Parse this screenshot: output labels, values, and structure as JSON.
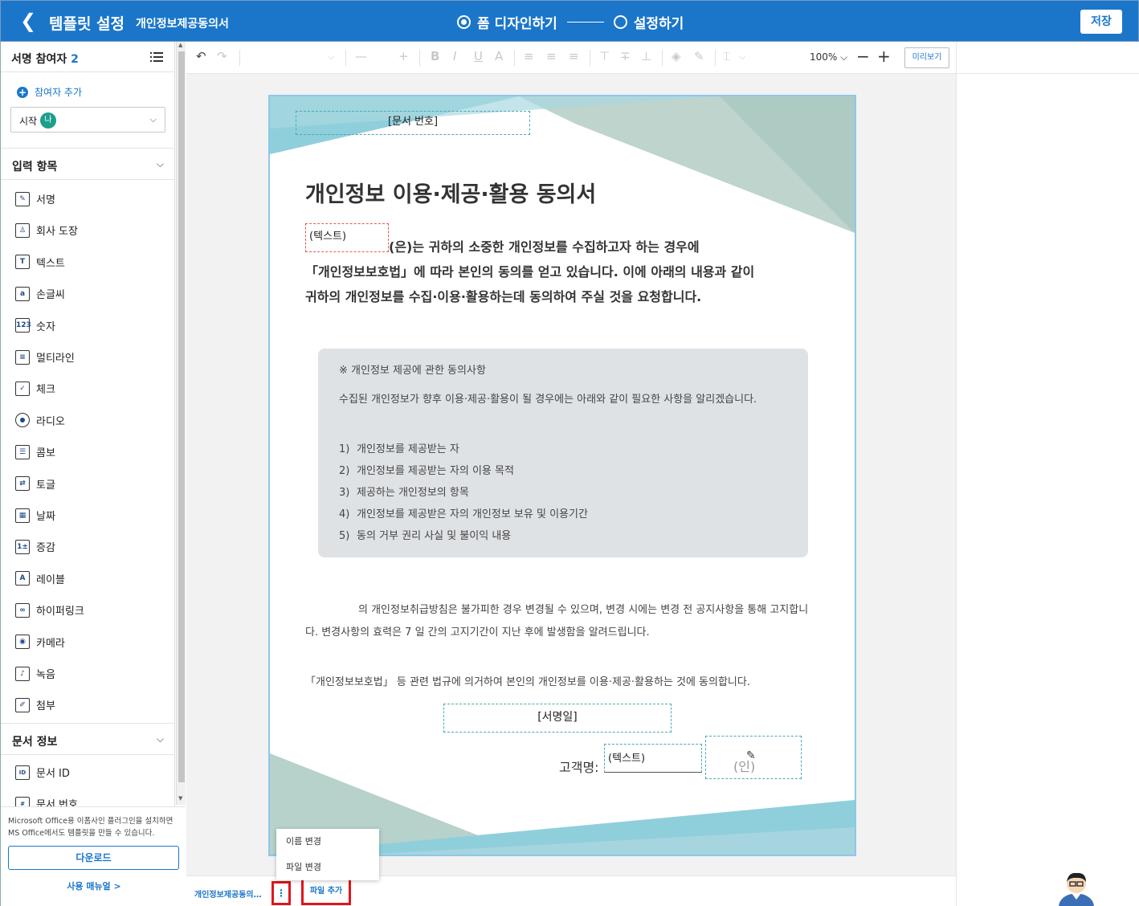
{
  "header": {
    "back_icon": "chevron-left-icon",
    "title": "템플릿 설정",
    "subtitle": "개인정보제공동의서",
    "step1": "폼 디자인하기",
    "step2": "설정하기",
    "save": "저장",
    "color": "#1b76c9"
  },
  "sidebar": {
    "signers_label": "서명 참여자",
    "signers_count": "2",
    "add_participant": "참여자 추가",
    "participant_select": {
      "label": "시작",
      "avatar": "나"
    },
    "input_section": "입력 항목",
    "items": [
      {
        "label": "서명",
        "icon": "signature-icon",
        "glyph": "✎"
      },
      {
        "label": "회사 도장",
        "icon": "stamp-icon",
        "glyph": "♙"
      },
      {
        "label": "텍스트",
        "icon": "text-icon",
        "glyph": "T"
      },
      {
        "label": "손글씨",
        "icon": "handwriting-icon",
        "glyph": "a"
      },
      {
        "label": "숫자",
        "icon": "number-icon",
        "glyph": "123"
      },
      {
        "label": "멀티라인",
        "icon": "multiline-icon",
        "glyph": "≡"
      },
      {
        "label": "체크",
        "icon": "checkbox-icon",
        "glyph": "✓"
      },
      {
        "label": "라디오",
        "icon": "radio-icon",
        "glyph": ""
      },
      {
        "label": "콤보",
        "icon": "combo-icon",
        "glyph": "☰"
      },
      {
        "label": "토글",
        "icon": "toggle-icon",
        "glyph": "⇄"
      },
      {
        "label": "날짜",
        "icon": "calendar-icon",
        "glyph": "▦"
      },
      {
        "label": "증감",
        "icon": "stepper-icon",
        "glyph": "1±"
      },
      {
        "label": "레이블",
        "icon": "label-icon",
        "glyph": "A"
      },
      {
        "label": "하이퍼링크",
        "icon": "link-icon",
        "glyph": "∞"
      },
      {
        "label": "카메라",
        "icon": "camera-icon",
        "glyph": "◉"
      },
      {
        "label": "녹음",
        "icon": "microphone-icon",
        "glyph": "♪"
      },
      {
        "label": "첨부",
        "icon": "attachment-icon",
        "glyph": "✐"
      }
    ],
    "doc_info_section": "문서 정보",
    "doc_items": [
      {
        "label": "문서 ID",
        "icon": "document-id-icon",
        "glyph": "ID"
      },
      {
        "label": "문서 번호",
        "icon": "document-number-icon",
        "glyph": "#"
      }
    ],
    "footer_note": "Microsoft Office용 이폼사인 플러그인을 설치하면 MS Office에서도 템플릿을 만들 수 있습니다.",
    "download": "다운로드",
    "manual": "사용 매뉴얼 >"
  },
  "toolbar": {
    "zoom": "100%",
    "preview": "미리보기"
  },
  "document": {
    "doc_number_field": "[문서 번호]",
    "title": "개인정보 이용·제공·활용 동의서",
    "text_field_1": "(텍스트)",
    "intro_after_field": "(은)는 귀하의 소중한 개인정보를 수집하고자 하는 경우에",
    "intro_line2": "「개인정보보호법」에 따라 본인의 동의를 얻고 있습니다. 이에 아래의 내용과 같이",
    "intro_line3": "귀하의 개인정보를 수집·이용·활용하는데 동의하여 주실 것을 요청합니다.",
    "box_heading": "※ 개인정보 제공에 관한 동의사항",
    "box_paragraph": "수집된 개인정보가 향후 이용·제공·활용이 될 경우에는 아래와 같이 필요한 사항을 알리겠습니다.",
    "box_items": [
      {
        "n": "1)",
        "text": "개인정보를 제공받는 자"
      },
      {
        "n": "2)",
        "text": "개인정보를 제공받는 자의 이용 목적"
      },
      {
        "n": "3)",
        "text": "제공하는 개인정보의 항목"
      },
      {
        "n": "4)",
        "text": "개인정보를 제공받은 자의 개인정보 보유 및 이용기간"
      },
      {
        "n": "5)",
        "text": "동의 거부 권리 사실 및 불이익 내용"
      }
    ],
    "para2": "의 개인정보취급방침은 불가피한 경우 변경될 수 있으며, 변경 시에는 변경 전 공지사항을 통해 고지합니다. 변경사항의 효력은 7 일 간의 고지기간이 지난 후에 발생함을 알려드립니다.",
    "para3": "「개인정보보호법」 등 관련 법규에 의거하여 본인의 개인정보를 이용·제공·활용하는 것에 동의합니다.",
    "sign_date_field": "[서명일]",
    "customer_label": "고객명:",
    "text_field_2": "(텍스트)",
    "seal_text": "(인)"
  },
  "filebar": {
    "file_name": "개인정보제공동의…",
    "kebab": "⋮",
    "add_file": "파일 추가"
  },
  "context_menu": {
    "rename": "이름 변경",
    "change_file": "파일 변경"
  }
}
